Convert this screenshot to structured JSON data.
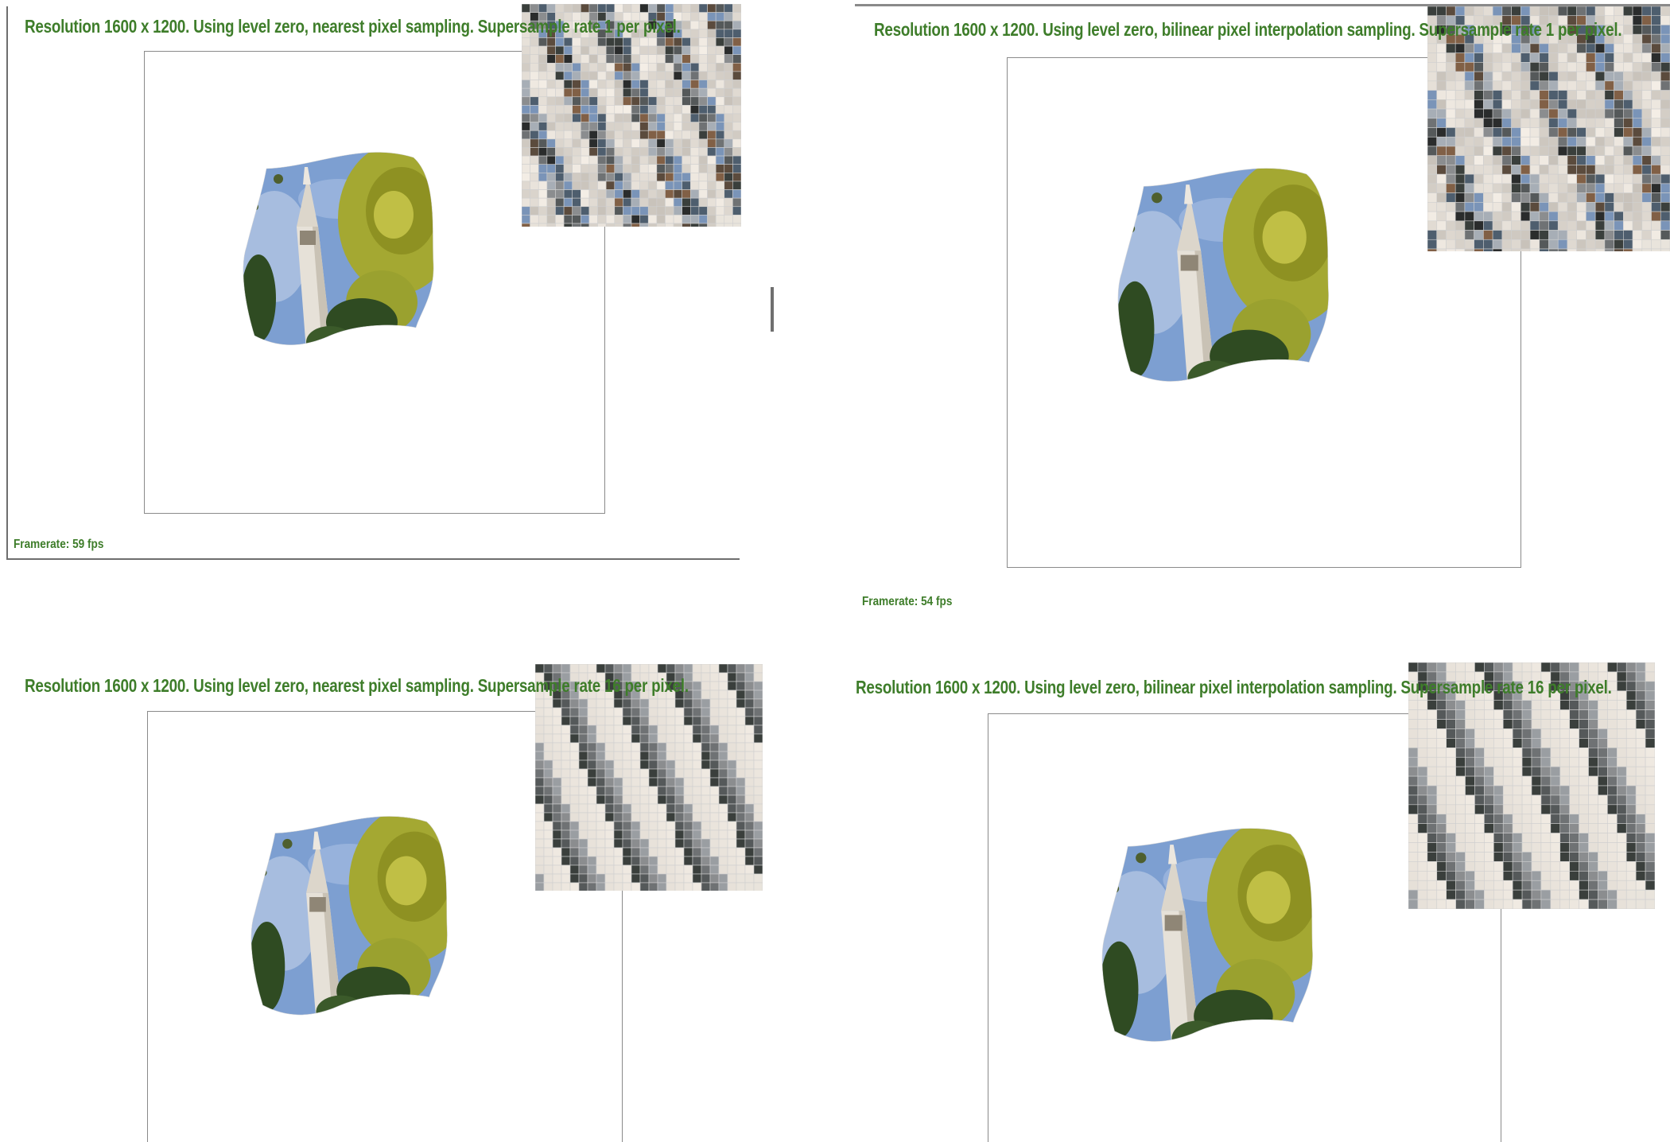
{
  "panels": [
    {
      "title": "Resolution 1600 x 1200. Using level zero, nearest pixel sampling. Supersample rate 1 per pixel.",
      "framerate": "Framerate: 59 fps",
      "sampling": "nearest",
      "supersample": 1
    },
    {
      "title": "Resolution 1600 x 1200. Using level zero, bilinear pixel interpolation sampling. Supersample rate 1 per pixel.",
      "framerate": "Framerate: 54 fps",
      "sampling": "bilinear",
      "supersample": 1
    },
    {
      "title": "Resolution 1600 x 1200. Using level zero, nearest pixel sampling. Supersample rate 16 per pixel.",
      "framerate": "",
      "sampling": "nearest",
      "supersample": 16
    },
    {
      "title": "Resolution 1600 x 1200. Using level zero, bilinear pixel interpolation sampling. Supersample rate 16 per pixel.",
      "framerate": "",
      "sampling": "bilinear",
      "supersample": 16
    }
  ],
  "colors": {
    "text": "#3e7d2a",
    "sky": "#7d9fd1",
    "tower": "#e6e1d8",
    "foliage": "#a4a832",
    "trees": "#2f4b22"
  }
}
